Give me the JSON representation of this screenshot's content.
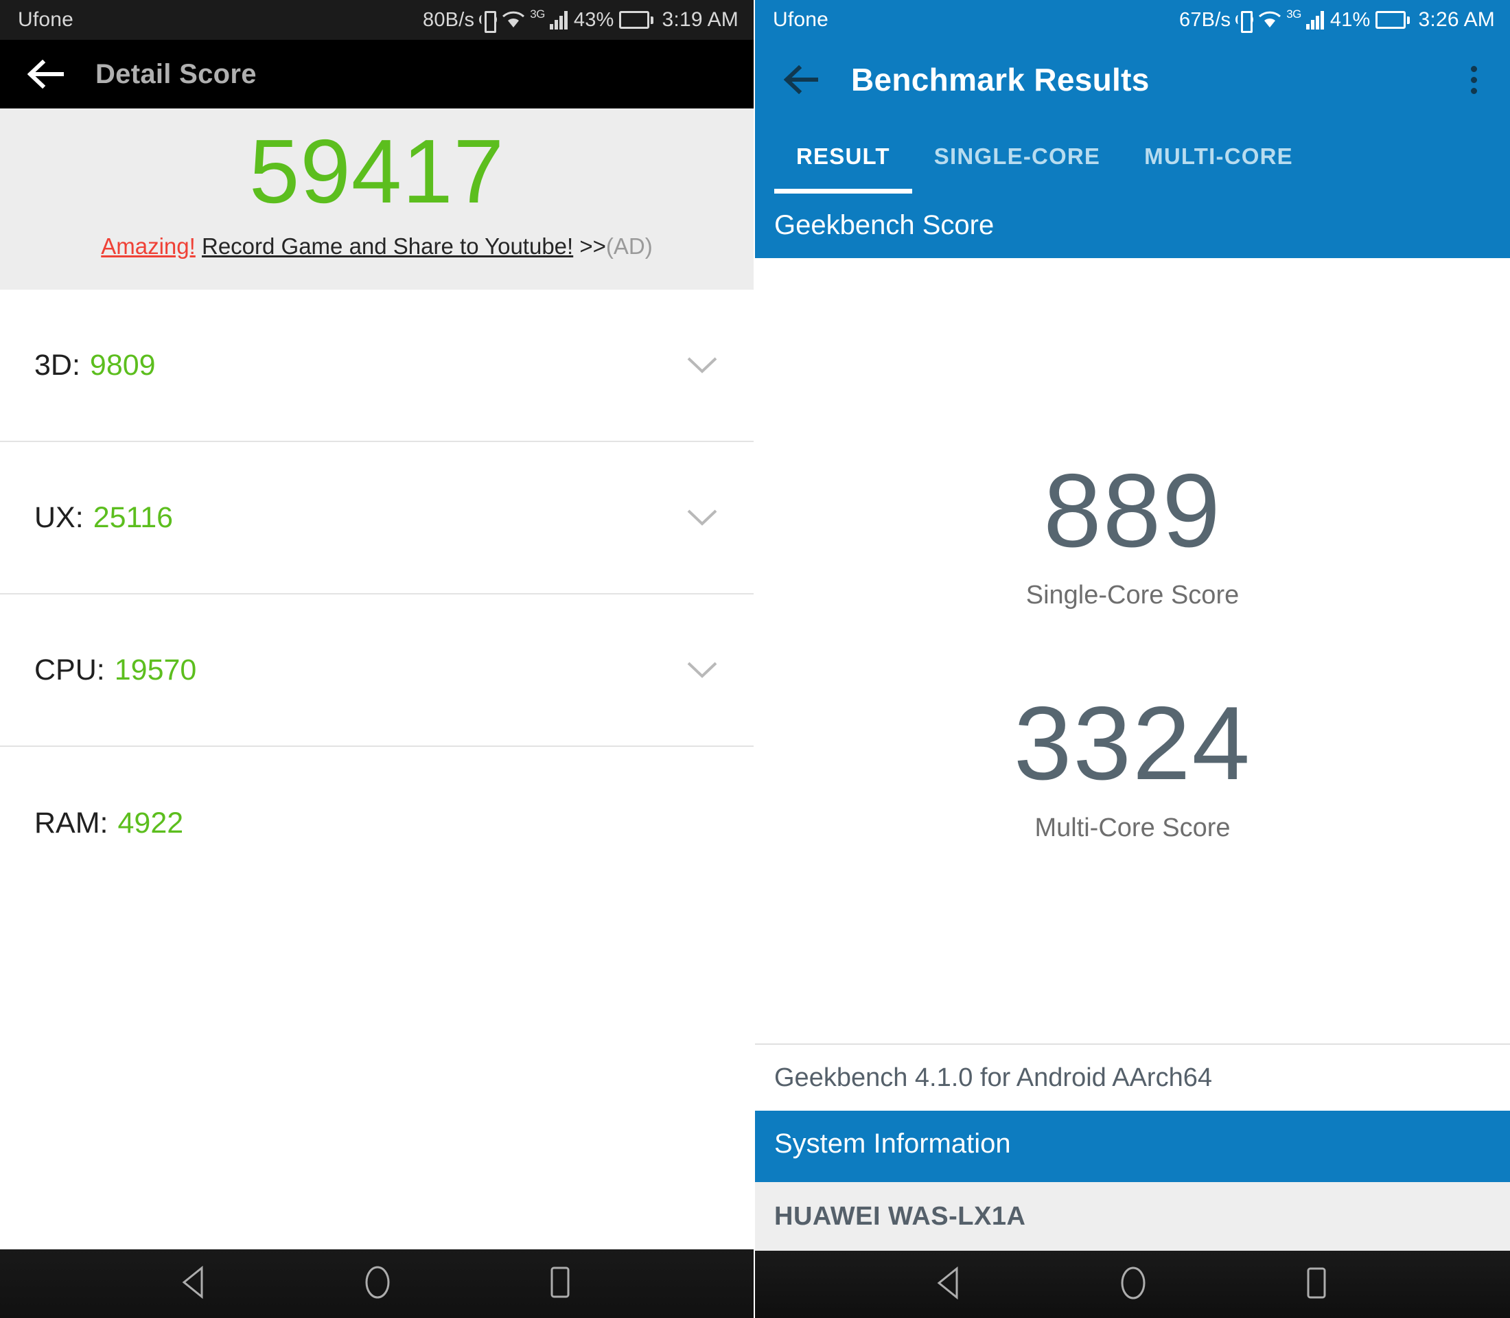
{
  "left_screen": {
    "status_bar": {
      "carrier": "Ufone",
      "network_speed": "80B/s",
      "battery_percent": "43%",
      "time": "3:19 AM",
      "network_type": "3G",
      "icons": [
        "vibrate-icon",
        "wifi-icon",
        "signal-bars-icon",
        "battery-icon"
      ]
    },
    "app_bar": {
      "back_label": "back-arrow",
      "title": "Detail Score"
    },
    "hero": {
      "total_score": "59417",
      "score_color": "#5cbe1e",
      "ad": {
        "highlight": "Amazing!",
        "text": "Record Game and Share to Youtube!",
        "arrows": " >>",
        "tag": "(AD)"
      }
    },
    "detail_rows": [
      {
        "label": "3D:",
        "value": "9809",
        "expandable": true
      },
      {
        "label": "UX:",
        "value": "25116",
        "expandable": true
      },
      {
        "label": "CPU:",
        "value": "19570",
        "expandable": true
      },
      {
        "label": "RAM:",
        "value": "4922",
        "expandable": false
      }
    ],
    "nav_bar": [
      "back-triangle-icon",
      "home-circle-icon",
      "recents-square-icon"
    ]
  },
  "right_screen": {
    "status_bar": {
      "carrier": "Ufone",
      "network_speed": "67B/s",
      "battery_percent": "41%",
      "time": "3:26 AM",
      "network_type": "3G",
      "icons": [
        "vibrate-icon",
        "wifi-icon",
        "signal-bars-icon",
        "battery-icon"
      ]
    },
    "app_bar": {
      "title": "Benchmark Results",
      "back_label": "back-arrow",
      "overflow_label": "more-options"
    },
    "tabs": [
      {
        "label": "RESULT",
        "active": true
      },
      {
        "label": "SINGLE-CORE",
        "active": false
      },
      {
        "label": "MULTI-CORE",
        "active": false
      }
    ],
    "sections": {
      "score_header": "Geekbench Score",
      "system_header": "System Information"
    },
    "scores": [
      {
        "value": "889",
        "label": "Single-Core Score"
      },
      {
        "value": "3324",
        "label": "Multi-Core Score"
      }
    ],
    "version_line": "Geekbench 4.1.0 for Android AArch64",
    "device_name": "HUAWEI WAS-LX1A",
    "accent_color": "#0d7cc0",
    "nav_bar": [
      "back-triangle-icon",
      "home-circle-icon",
      "recents-square-icon"
    ]
  }
}
